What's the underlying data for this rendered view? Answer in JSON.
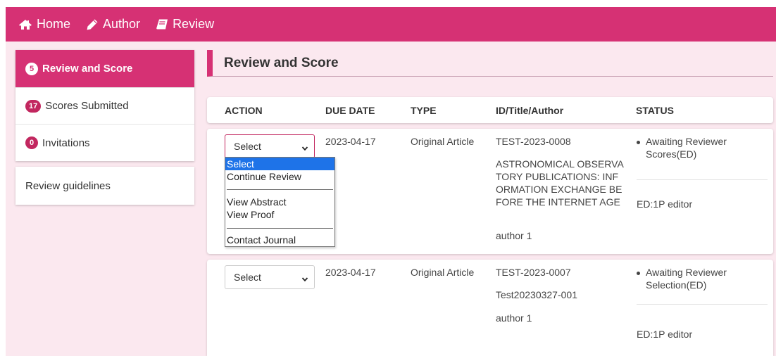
{
  "nav": {
    "items": [
      {
        "label": "Home",
        "icon": "home-icon"
      },
      {
        "label": "Author",
        "icon": "pencil-icon"
      },
      {
        "label": "Review",
        "icon": "book-icon"
      }
    ]
  },
  "sidebar": {
    "items": [
      {
        "badge": "5",
        "label": "Review and Score",
        "active": true
      },
      {
        "badge": "17",
        "label": "Scores Submitted",
        "active": false
      },
      {
        "badge": "0",
        "label": "Invitations",
        "active": false
      }
    ],
    "guidelines_label": "Review guidelines"
  },
  "main": {
    "title": "Review and Score",
    "columns": [
      "ACTION",
      "DUE DATE",
      "TYPE",
      "ID/Title/Author",
      "STATUS"
    ],
    "rows": [
      {
        "action": "Select",
        "due_date": "2023-04-17",
        "type": "Original Article",
        "id": "TEST-2023-0008",
        "title_lines": [
          "ASTRONOMICAL OBSERVA",
          "TORY PUBLICATIONS: INF",
          "ORMATION EXCHANGE BE",
          "FORE THE INTERNET AGE"
        ],
        "author": "author 1",
        "status_lines": [
          "Awaiting Reviewer",
          "Scores(ED)"
        ],
        "editor": "ED:1P editor"
      },
      {
        "action": "Select",
        "due_date": "2023-04-17",
        "type": "Original Article",
        "id": "TEST-2023-0007",
        "title_lines": [
          "Test20230327-001"
        ],
        "author": "author 1",
        "status_lines": [
          "Awaiting Reviewer",
          "Selection(ED)"
        ],
        "editor": "ED:1P editor"
      }
    ]
  },
  "dropdown": {
    "options": [
      "Select",
      "Continue Review",
      "View Abstract",
      "View Proof",
      "Contact Journal"
    ],
    "selected": "Select"
  },
  "colors": {
    "accent": "#d63174",
    "page_bg": "#fbe8ef",
    "option_highlight": "#1e73e8"
  }
}
